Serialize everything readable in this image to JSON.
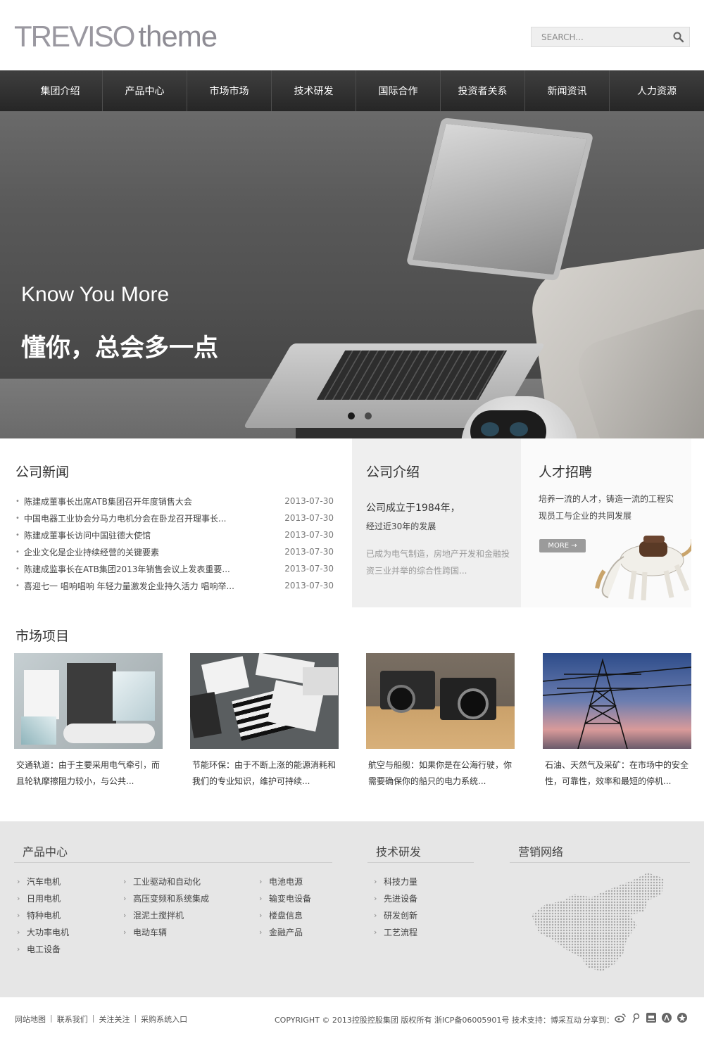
{
  "header": {
    "logo_brand": "TREVISO",
    "logo_suffix": "theme",
    "search_placeholder": "SEARCH..."
  },
  "nav": [
    "集团介绍",
    "产品中心",
    "市场市场",
    "技术研发",
    "国际合作",
    "投资者关系",
    "新闻资讯",
    "人力资源"
  ],
  "hero": {
    "title": "Know You More",
    "subtitle": "懂你，总会多一点",
    "slides": 2,
    "active_slide": 1
  },
  "news": {
    "title": "公司新闻",
    "items": [
      {
        "title": "陈建成董事长出席ATB集团召开年度销售大会",
        "date": "2013-07-30"
      },
      {
        "title": "中国电器工业协会分马力电机分会在卧龙召开理事长...",
        "date": "2013-07-30"
      },
      {
        "title": "陈建成董事长访问中国驻德大使馆",
        "date": "2013-07-30"
      },
      {
        "title": "企业文化是企业持续经营的关键要素",
        "date": "2013-07-30"
      },
      {
        "title": "陈建成监事长在ATB集团2013年销售会议上发表重要...",
        "date": "2013-07-30"
      },
      {
        "title": "喜迎七一 唱响唱响 年轻力量激发企业持久活力 唱响举...",
        "date": "2013-07-30"
      }
    ]
  },
  "about": {
    "title": "公司介绍",
    "line1": "公司成立于1984年，",
    "line2": "经过近30年的发展",
    "line3": "已成为电气制造，房地产开发和金融投资三业并举的综合性跨国..."
  },
  "jobs": {
    "title": "人才招聘",
    "desc": "培养一流的人才，铸造一流的工程实现员工与企业的共同发展",
    "more": "MORE →"
  },
  "market": {
    "title": "市场项目",
    "items": [
      {
        "caption": "交通轨道：由于主要采用电气牵引，而且轮轨摩擦阻力较小，与公共..."
      },
      {
        "caption": "节能环保：由于不断上涨的能源消耗和我们的专业知识，维护可持续..."
      },
      {
        "caption": "航空与船舰：如果你是在公海行驶，你需要确保你的船只的电力系统..."
      },
      {
        "caption": "石油、天然气及采矿：在市场中的安全性，可靠性，效率和最短的停机..."
      }
    ]
  },
  "footer": {
    "products_title": "产品中心",
    "products_col1": [
      "汽车电机",
      "日用电机",
      "特种电机",
      "大功率电机",
      "电工设备"
    ],
    "products_col2": [
      "工业驱动和自动化",
      "高压变频和系统集成",
      "混泥土搅拌机",
      "电动车辆"
    ],
    "products_col3": [
      "电池电源",
      "输变电设备",
      "楼盘信息",
      "金融产品"
    ],
    "tech_title": "技术研发",
    "tech_items": [
      "科技力量",
      "先进设备",
      "研发创新",
      "工艺流程"
    ],
    "network_title": "营销网络"
  },
  "bottom": {
    "links": [
      "网站地图",
      "联系我们",
      "关注关注",
      "采购系统入口"
    ],
    "copyright": "COPYRIGHT © 2013控股控股集团 版权所有 浙ICP备06005901号 技术支持：博采互动",
    "share_label": "分享到："
  },
  "colors": {
    "nav_bg": "#2f2f2f",
    "about_bg": "#efefef",
    "footer_bg": "#e6e6e6"
  }
}
